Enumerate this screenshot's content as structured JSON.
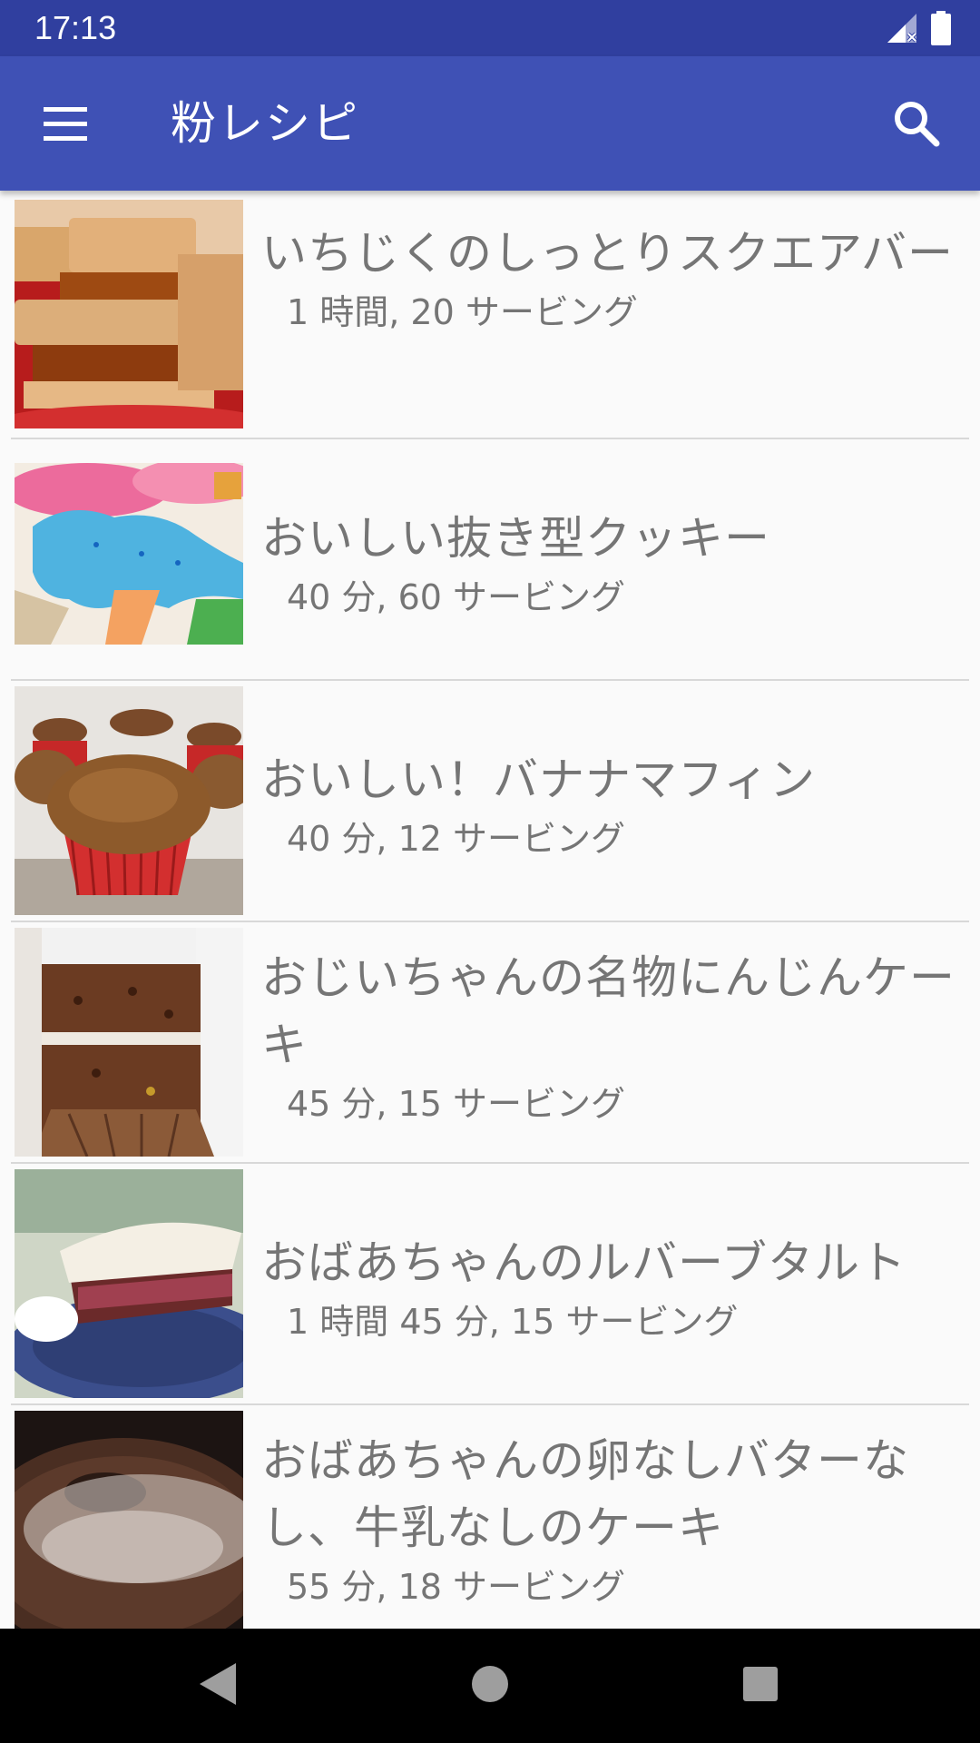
{
  "status_bar": {
    "time": "17:13"
  },
  "app_bar": {
    "title": "粉レシピ",
    "menu_icon": "hamburger-menu-icon",
    "search_icon": "search-icon",
    "color": "#3f51b5",
    "status_color": "#303f9f"
  },
  "recipes": [
    {
      "title": "いちじくのしっとりスクエアバー",
      "subtitle": "1 時間, 20 サービング",
      "image": "fig-bars"
    },
    {
      "title": "おいしい抜き型クッキー",
      "subtitle": "40 分, 60 サービング",
      "image": "cutout-cookies"
    },
    {
      "title": "おいしい！バナナマフィン",
      "subtitle": "40 分, 12 サービング",
      "image": "banana-muffins"
    },
    {
      "title": "おじいちゃんの名物にんじんケーキ",
      "subtitle": "45 分, 15 サービング",
      "image": "carrot-cake"
    },
    {
      "title": "おばあちゃんのルバーブタルト",
      "subtitle": "1 時間 45 分, 15 サービング",
      "image": "rhubarb-tart"
    },
    {
      "title": "おばあちゃんの卵なしバターなし、牛乳なしのケーキ",
      "subtitle": "55 分, 18 サービング",
      "image": "bundt-cake"
    }
  ],
  "nav_bar": {
    "back_icon": "back-triangle-icon",
    "home_icon": "home-circle-icon",
    "recents_icon": "recents-square-icon"
  }
}
